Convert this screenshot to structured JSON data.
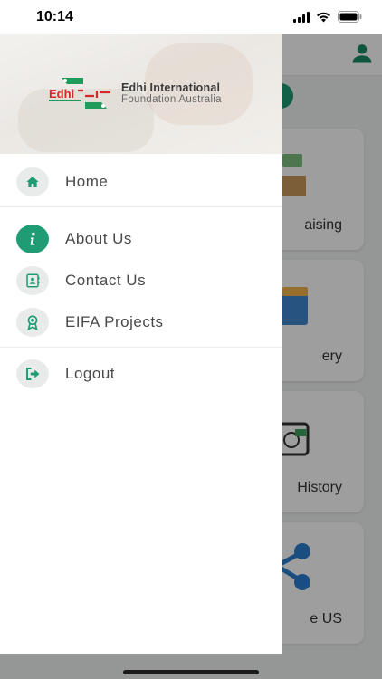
{
  "status_bar": {
    "time": "10:14"
  },
  "drawer": {
    "org_name": "Edhi International",
    "org_sub": "Foundation Australia",
    "logo_text": "Edhi",
    "items": [
      {
        "label": "Home",
        "icon": "home-icon"
      },
      {
        "label": "About Us",
        "icon": "info-icon"
      },
      {
        "label": "Contact Us",
        "icon": "contact-card-icon"
      },
      {
        "label": "EIFA Projects",
        "icon": "award-icon"
      },
      {
        "label": "Logout",
        "icon": "logout-icon"
      }
    ]
  },
  "background": {
    "cards": [
      {
        "label": "aising"
      },
      {
        "label": "ery"
      },
      {
        "label": "History"
      },
      {
        "label": "e US"
      }
    ]
  },
  "colors": {
    "accent": "#1f9c74",
    "drawer_bg": "#ffffff",
    "icon_bg": "#e8ebea"
  }
}
